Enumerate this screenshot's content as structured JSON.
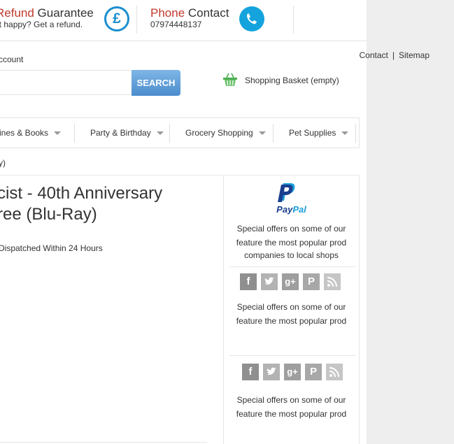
{
  "header": {
    "refund": {
      "title_highlight": "Refund",
      "title_rest": " Guarantee",
      "subtitle": "ot happy? Get a refund."
    },
    "phone": {
      "title_highlight": "Phone",
      "title_rest": " Contact",
      "number": "07974448137"
    }
  },
  "account": {
    "link": "ccount"
  },
  "search": {
    "placeholder": "",
    "button_label": "SEARCH"
  },
  "toplinks": {
    "contact": "Contact",
    "separator": "|",
    "sitemap": "Sitemap"
  },
  "basket": {
    "label": "Shopping Basket (empty)"
  },
  "nav": {
    "items": [
      {
        "label": "zines & Books"
      },
      {
        "label": "Party & Birthday"
      },
      {
        "label": "Grocery Shopping"
      },
      {
        "label": "Pet Supplies"
      }
    ]
  },
  "breadcrumb": {
    "text": "y)"
  },
  "product": {
    "title_line1": "cist - 40th Anniversary",
    "title_line2": "ree (Blu-Ray)",
    "dispatch": "Dispatched Within 24 Hours"
  },
  "sidebar": {
    "paypal": {
      "word_1": "Pay",
      "word_2": "Pal"
    },
    "block1": {
      "line1": "Special offers on some of our",
      "line2": "feature the most popular prod",
      "line3": "companies to local shops"
    },
    "block2": {
      "line1": "Special offers on some of our",
      "line2": "feature the most popular prod"
    },
    "block3": {
      "line1": "Special offers on some of our",
      "line2": "feature the most popular prod"
    },
    "social_icons": [
      "facebook-icon",
      "twitter-icon",
      "google-plus-icon",
      "pinterest-icon",
      "rss-icon"
    ],
    "social_labels": {
      "facebook": "f",
      "googleplus": "g+",
      "pinterest": "P"
    }
  },
  "colors": {
    "accent_red": "#c0392b",
    "brand_blue": "#1b8fcf",
    "search_blue": "#4a8ccc",
    "social_grey": "#9a9a9a"
  }
}
